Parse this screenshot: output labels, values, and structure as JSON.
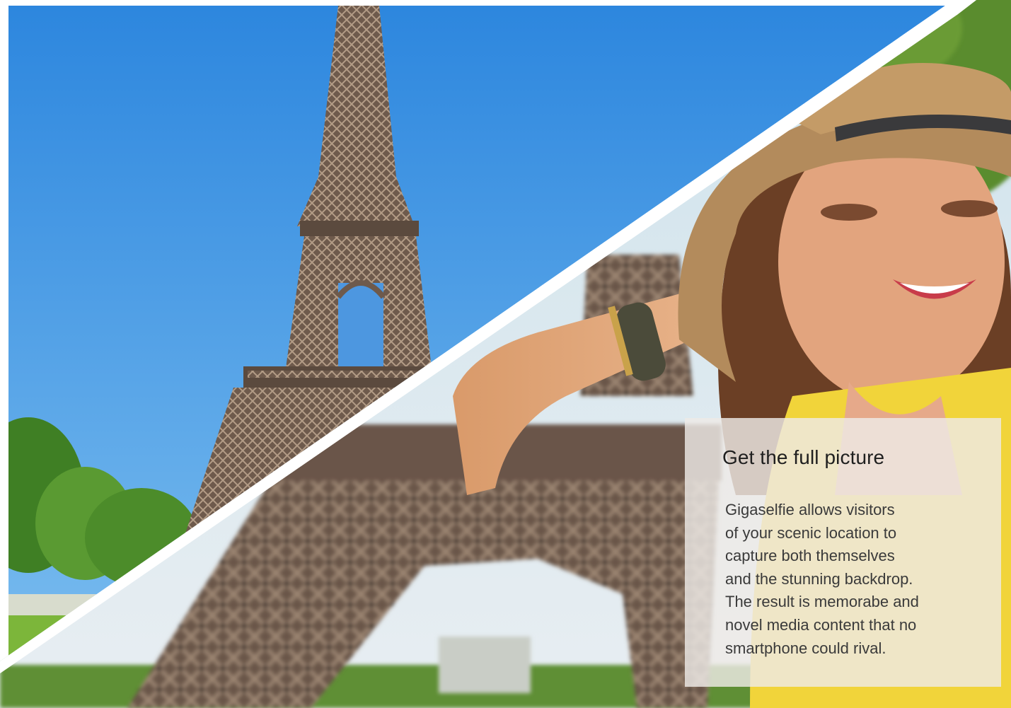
{
  "card": {
    "title": "Get the full picture",
    "body": "Gigaselfie allows visitors\nof your scenic location to\ncapture both themselves\nand the stunning backdrop.\nThe result is memorabe and\nnovel media content that no\nsmartphone could rival."
  },
  "colors": {
    "sky": "#3f9be3",
    "tower": "#7a6556",
    "hat": "#b08a5b",
    "dress": "#f1d43a",
    "trees": "#4f8f2e",
    "divider": "#ffffff"
  },
  "imagery": {
    "left_panel": "eiffel-tower-photo",
    "right_panel": "woman-in-hat-selfie-photo"
  }
}
